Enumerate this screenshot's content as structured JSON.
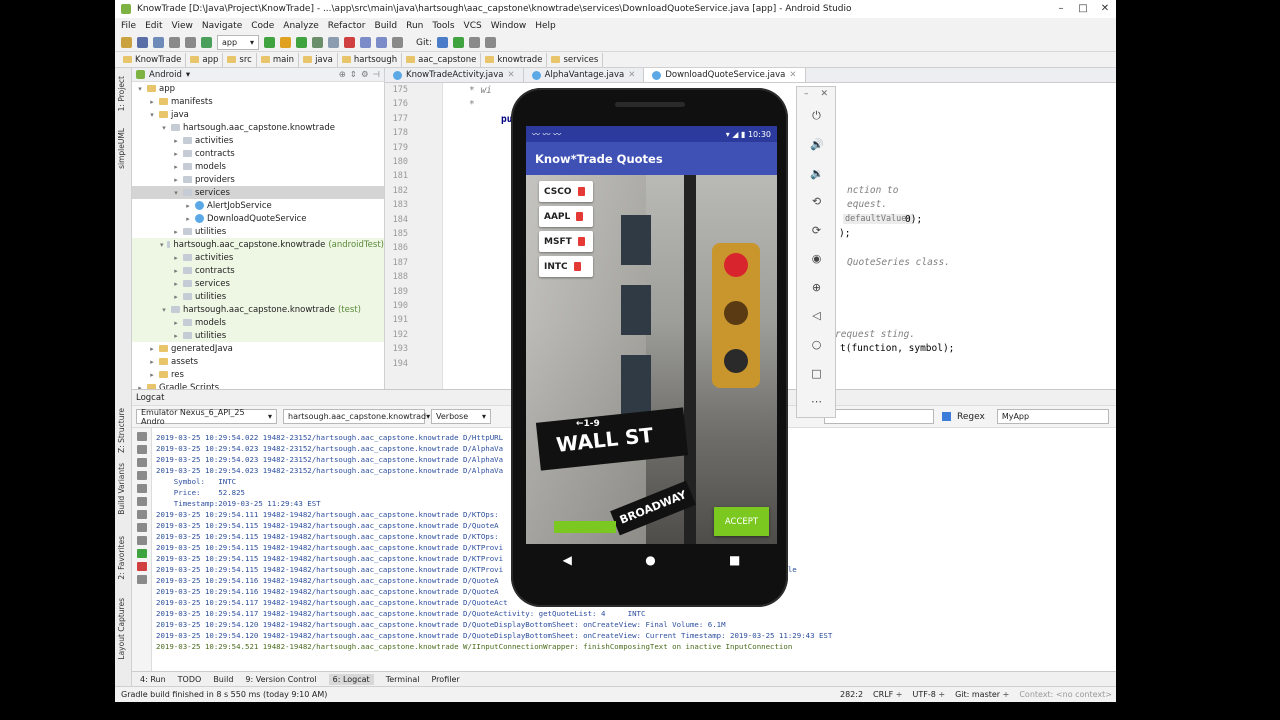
{
  "window": {
    "title": "KnowTrade [D:\\Java\\Project\\KnowTrade] - ...\\app\\src\\main\\java\\hartsough\\aac_capstone\\knowtrade\\services\\DownloadQuoteService.java [app] - Android Studio",
    "minimize": "–",
    "maximize": "□",
    "close": "✕"
  },
  "menu": [
    "File",
    "Edit",
    "View",
    "Navigate",
    "Code",
    "Analyze",
    "Refactor",
    "Build",
    "Run",
    "Tools",
    "VCS",
    "Window",
    "Help"
  ],
  "toolbar": {
    "config": "app",
    "git": "Git:"
  },
  "breadcrumbs": [
    "KnowTrade",
    "app",
    "src",
    "main",
    "java",
    "hartsough",
    "aac_capstone",
    "knowtrade",
    "services"
  ],
  "project_panel": {
    "view": "Android",
    "side_tabs": [
      "1: Project",
      "simpleUML"
    ],
    "tree": [
      {
        "label": "app",
        "level": 0,
        "kind": "folder",
        "arrow": "▾"
      },
      {
        "label": "manifests",
        "level": 1,
        "kind": "folder",
        "arrow": "▸"
      },
      {
        "label": "java",
        "level": 1,
        "kind": "folder",
        "arrow": "▾"
      },
      {
        "label": "hartsough.aac_capstone.knowtrade",
        "level": 2,
        "kind": "pkg",
        "arrow": "▾"
      },
      {
        "label": "activities",
        "level": 3,
        "kind": "pkg",
        "arrow": "▸"
      },
      {
        "label": "contracts",
        "level": 3,
        "kind": "pkg",
        "arrow": "▸"
      },
      {
        "label": "models",
        "level": 3,
        "kind": "pkg",
        "arrow": "▸"
      },
      {
        "label": "providers",
        "level": 3,
        "kind": "pkg",
        "arrow": "▸"
      },
      {
        "label": "services",
        "level": 3,
        "kind": "pkg",
        "arrow": "▾",
        "selected": true
      },
      {
        "label": "AlertJobService",
        "level": 4,
        "kind": "class",
        "arrow": "▸"
      },
      {
        "label": "DownloadQuoteService",
        "level": 4,
        "kind": "class",
        "arrow": "▸"
      },
      {
        "label": "utilities",
        "level": 3,
        "kind": "pkg",
        "arrow": "▸"
      },
      {
        "label": "hartsough.aac_capstone.knowtrade",
        "suffix": "(androidTest)",
        "level": 2,
        "kind": "pkg",
        "arrow": "▾",
        "green": true
      },
      {
        "label": "activities",
        "level": 3,
        "kind": "pkg",
        "arrow": "▸",
        "green": true
      },
      {
        "label": "contracts",
        "level": 3,
        "kind": "pkg",
        "arrow": "▸",
        "green": true
      },
      {
        "label": "services",
        "level": 3,
        "kind": "pkg",
        "arrow": "▸",
        "green": true
      },
      {
        "label": "utilities",
        "level": 3,
        "kind": "pkg",
        "arrow": "▸",
        "green": true
      },
      {
        "label": "hartsough.aac_capstone.knowtrade",
        "suffix": "(test)",
        "level": 2,
        "kind": "pkg",
        "arrow": "▾",
        "green": true
      },
      {
        "label": "models",
        "level": 3,
        "kind": "pkg",
        "arrow": "▸",
        "green": true
      },
      {
        "label": "utilities",
        "level": 3,
        "kind": "pkg",
        "arrow": "▸",
        "green": true
      },
      {
        "label": "generatedJava",
        "level": 1,
        "kind": "folder",
        "arrow": "▸"
      },
      {
        "label": "assets",
        "level": 1,
        "kind": "folder",
        "arrow": "▸"
      },
      {
        "label": "res",
        "level": 1,
        "kind": "folder",
        "arrow": "▸"
      },
      {
        "label": "Gradle Scripts",
        "level": 0,
        "kind": "folder",
        "arrow": "▸"
      }
    ]
  },
  "editor": {
    "tabs": [
      "KnowTradeActivity.java",
      "AlphaVantage.java",
      "DownloadQuoteService.java"
    ],
    "active_tab": 2,
    "line_numbers": [
      "175",
      "176",
      "177",
      "178",
      "179",
      "180",
      "181",
      "182",
      "183",
      "184",
      "185",
      "186",
      "187",
      "188",
      "189",
      "190",
      "191",
      "192",
      "193",
      "194"
    ],
    "fragments": [
      "* wi",
      "*",
      "pu",
      "nction to",
      "equest.",
      "defaultValue:",
      "0);",
      ");",
      "QuoteSeries class.",
      "request sting.",
      "t(function, symbol);"
    ]
  },
  "emulator": {
    "status_time": "10:30",
    "app_title": "Know*Trade Quotes",
    "quotes": [
      "CSCO",
      "AAPL",
      "MSFT",
      "INTC"
    ],
    "accept_label": "ACCEPT",
    "street_sign": "WALL ST",
    "street_sign_num": "1-9",
    "broadway": "BROADWAY",
    "panel_buttons": [
      "power-icon",
      "volume-up-icon",
      "volume-down-icon",
      "rotate-left-icon",
      "rotate-right-icon",
      "camera-icon",
      "zoom-icon",
      "back-icon",
      "home-icon",
      "overview-icon",
      "more-icon"
    ]
  },
  "logcat": {
    "title": "Logcat",
    "device": "Emulator Nexus_6_API_25 Andro",
    "package": "hartsough.aac_capstone.knowtrad",
    "level": "Verbose",
    "regex_label": "Regex",
    "filter": "MyApp",
    "side_tabs": [
      "Z: Structure",
      "Build Variants",
      "2: Favorites",
      "Layout Captures"
    ],
    "lines": [
      "2019-03-25 10:29:54.022 19482-23152/hartsough.aac_capstone.knowtrade D/HttpURL",
      "2019-03-25 10:29:54.023 19482-23152/hartsough.aac_capstone.knowtrade D/AlphaVa",
      "2019-03-25 10:29:54.023 19482-23152/hartsough.aac_capstone.knowtrade D/AlphaVa",
      "2019-03-25 10:29:54.023 19482-23152/hartsough.aac_capstone.knowtrade D/AlphaVa",
      "    Symbol:   INTC",
      "    Price:    52.825",
      "    Timestamp:2019-03-25 11:29:43 EST",
      "2019-03-25 10:29:54.111 19482-19482/hartsough.aac_capstone.knowtrade D/KTOps:",
      "2019-03-25 10:29:54.115 19482-19482/hartsough.aac_capstone.knowtrade D/QuoteA",
      "2019-03-25 10:29:54.115 19482-19482/hartsough.aac_capstone.knowtrade D/KTOps:",
      "2019-03-25 10:29:54.115 19482-19482/hartsough.aac_capstone.knowtrade D/KTProvi                                      knowtrade/quote_table",
      "2019-03-25 10:29:54.115 19482-19482/hartsough.aac_capstone.knowtrade D/KTProvi",
      "2019-03-25 10:29:54.115 19482-19482/hartsough.aac_capstone.knowtrade D/KTProvi                                      pstone.knowtrade/quote_table",
      "2019-03-25 10:29:54.116 19482-19482/hartsough.aac_capstone.knowtrade D/QuoteA",
      "2019-03-25 10:29:54.116 19482-19482/hartsough.aac_capstone.knowtrade D/QuoteA",
      "2019-03-25 10:29:54.117 19482-19482/hartsough.aac_capstone.knowtrade D/QuoteAct",
      "2019-03-25 10:29:54.117 19482-19482/hartsough.aac_capstone.knowtrade D/QuoteActivity: getQuoteList: 4     INTC",
      "2019-03-25 10:29:54.120 19482-19482/hartsough.aac_capstone.knowtrade D/QuoteDisplayBottomSheet: onCreateView: Final Volume: 6.1M",
      "2019-03-25 10:29:54.120 19482-19482/hartsough.aac_capstone.knowtrade D/QuoteDisplayBottomSheet: onCreateView: Current Timestamp: 2019-03-25 11:29:43 EST",
      "2019-03-25 10:29:54.521 19482-19482/hartsough.aac_capstone.knowtrade W/IInputConnectionWrapper: finishComposingText on inactive InputConnection"
    ]
  },
  "bottom_tools": [
    "4: Run",
    "TODO",
    "Build",
    "9: Version Control",
    "6: Logcat",
    "Terminal",
    "Profiler"
  ],
  "status": {
    "message": "Gradle build finished in 8 s 550 ms (today 9:10 AM)",
    "position": "282:2",
    "line_sep": "CRLF ÷",
    "encoding": "UTF-8 ÷",
    "git": "Git: master ÷",
    "context": "Context: <no context>"
  },
  "colors": {
    "app_bar": "#3f51b5",
    "status_bar": "#2b3a9c",
    "accent_green": "#7bc820",
    "trash": "#e53935"
  }
}
